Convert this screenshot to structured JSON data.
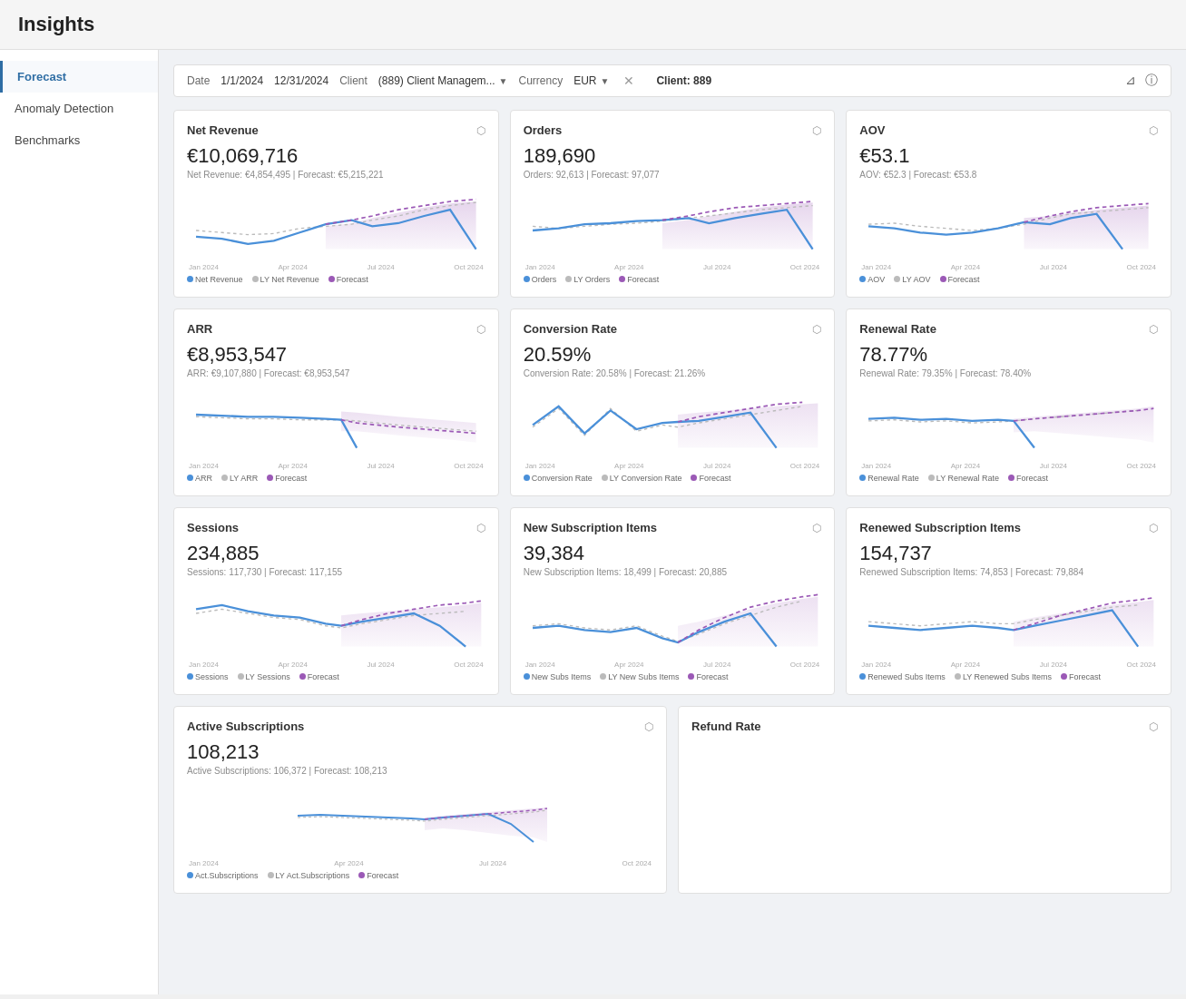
{
  "app": {
    "title": "Insights"
  },
  "sidebar": {
    "items": [
      {
        "label": "Forecast",
        "active": true
      },
      {
        "label": "Anomaly Detection",
        "active": false
      },
      {
        "label": "Benchmarks",
        "active": false
      }
    ]
  },
  "filters": {
    "date_label": "Date",
    "date_start": "1/1/2024",
    "date_end": "12/31/2024",
    "client_label": "Client",
    "client_value": "(889) Client Managem...",
    "currency_label": "Currency",
    "currency_value": "EUR",
    "client_badge": "Client: 889"
  },
  "cards": [
    {
      "id": "net-revenue",
      "title": "Net Revenue",
      "value": "€10,069,716",
      "subtitle": "Net Revenue: €4,854,495 | Forecast: €5,215,221",
      "x_labels": [
        "Jan 2024",
        "Apr 2024",
        "Jul 2024",
        "Oct 2024"
      ],
      "legend": [
        {
          "label": "Net Revenue",
          "color": "#4a90d9",
          "type": "solid"
        },
        {
          "label": "LY Net Revenue",
          "color": "#aaa",
          "type": "dashed"
        },
        {
          "label": "Forecast",
          "color": "#9b59b6",
          "type": "dashed"
        }
      ]
    },
    {
      "id": "orders",
      "title": "Orders",
      "value": "189,690",
      "subtitle": "Orders: 92,613 | Forecast: 97,077",
      "x_labels": [
        "Jan 2024",
        "Apr 2024",
        "Jul 2024",
        "Oct 2024"
      ],
      "legend": [
        {
          "label": "Orders",
          "color": "#4a90d9",
          "type": "solid"
        },
        {
          "label": "LY Orders",
          "color": "#aaa",
          "type": "dashed"
        },
        {
          "label": "Forecast",
          "color": "#9b59b6",
          "type": "dashed"
        }
      ]
    },
    {
      "id": "aov",
      "title": "AOV",
      "value": "€53.1",
      "subtitle": "AOV: €52.3 | Forecast: €53.8",
      "x_labels": [
        "Jan 2024",
        "Apr 2024",
        "Jul 2024",
        "Oct 2024"
      ],
      "legend": [
        {
          "label": "AOV",
          "color": "#4a90d9",
          "type": "solid"
        },
        {
          "label": "LY AOV",
          "color": "#aaa",
          "type": "dashed"
        },
        {
          "label": "Forecast",
          "color": "#9b59b6",
          "type": "dashed"
        }
      ]
    },
    {
      "id": "arr",
      "title": "ARR",
      "value": "€8,953,547",
      "subtitle": "ARR: €9,107,880 | Forecast: €8,953,547",
      "x_labels": [
        "Jan 2024",
        "Apr 2024",
        "Jul 2024",
        "Oct 2024"
      ],
      "legend": [
        {
          "label": "ARR",
          "color": "#4a90d9",
          "type": "solid"
        },
        {
          "label": "LY ARR",
          "color": "#aaa",
          "type": "dashed"
        },
        {
          "label": "Forecast",
          "color": "#9b59b6",
          "type": "dashed"
        }
      ]
    },
    {
      "id": "conversion-rate",
      "title": "Conversion Rate",
      "value": "20.59%",
      "subtitle": "Conversion Rate: 20.58% | Forecast: 21.26%",
      "x_labels": [
        "Jan 2024",
        "Apr 2024",
        "Jul 2024",
        "Oct 2024"
      ],
      "legend": [
        {
          "label": "Conversion Rate",
          "color": "#4a90d9",
          "type": "solid"
        },
        {
          "label": "LY Conversion Rate",
          "color": "#aaa",
          "type": "dashed"
        },
        {
          "label": "Forecast",
          "color": "#9b59b6",
          "type": "dashed"
        }
      ]
    },
    {
      "id": "renewal-rate",
      "title": "Renewal Rate",
      "value": "78.77%",
      "subtitle": "Renewal Rate: 79.35% | Forecast: 78.40%",
      "x_labels": [
        "Jan 2024",
        "Apr 2024",
        "Jul 2024",
        "Oct 2024"
      ],
      "legend": [
        {
          "label": "Renewal Rate",
          "color": "#4a90d9",
          "type": "solid"
        },
        {
          "label": "LY Renewal Rate",
          "color": "#aaa",
          "type": "dashed"
        },
        {
          "label": "Forecast",
          "color": "#9b59b6",
          "type": "dashed"
        }
      ]
    },
    {
      "id": "sessions",
      "title": "Sessions",
      "value": "234,885",
      "subtitle": "Sessions: 117,730 | Forecast: 117,155",
      "x_labels": [
        "Jan 2024",
        "Apr 2024",
        "Jul 2024",
        "Oct 2024"
      ],
      "legend": [
        {
          "label": "Sessions",
          "color": "#4a90d9",
          "type": "solid"
        },
        {
          "label": "LY Sessions",
          "color": "#aaa",
          "type": "dashed"
        },
        {
          "label": "Forecast",
          "color": "#9b59b6",
          "type": "dashed"
        }
      ]
    },
    {
      "id": "new-subscription-items",
      "title": "New Subscription Items",
      "value": "39,384",
      "subtitle": "New Subscription Items: 18,499 | Forecast: 20,885",
      "x_labels": [
        "Jan 2024",
        "Apr 2024",
        "Jul 2024",
        "Oct 2024"
      ],
      "legend": [
        {
          "label": "New Subs Items",
          "color": "#4a90d9",
          "type": "solid"
        },
        {
          "label": "LY New Subs Items",
          "color": "#aaa",
          "type": "dashed"
        },
        {
          "label": "Forecast",
          "color": "#9b59b6",
          "type": "dashed"
        }
      ]
    },
    {
      "id": "renewed-subscription-items",
      "title": "Renewed Subscription Items",
      "value": "154,737",
      "subtitle": "Renewed Subscription Items: 74,853 | Forecast: 79,884",
      "x_labels": [
        "Jan 2024",
        "Apr 2024",
        "Jul 2024",
        "Oct 2024"
      ],
      "legend": [
        {
          "label": "Renewed Subs Items",
          "color": "#4a90d9",
          "type": "solid"
        },
        {
          "label": "LY Renewed Subs Items",
          "color": "#aaa",
          "type": "dashed"
        },
        {
          "label": "Forecast",
          "color": "#9b59b6",
          "type": "dashed"
        }
      ]
    },
    {
      "id": "active-subscriptions",
      "title": "Active Subscriptions",
      "value": "108,213",
      "subtitle": "Active Subscriptions: 106,372 | Forecast: 108,213",
      "x_labels": [
        "Jan 2024",
        "Apr 2024",
        "Jul 2024",
        "Oct 2024"
      ],
      "legend": [
        {
          "label": "Act.Subscriptions",
          "color": "#4a90d9",
          "type": "solid"
        },
        {
          "label": "LY Act.Subscriptions",
          "color": "#aaa",
          "type": "dashed"
        },
        {
          "label": "Forecast",
          "color": "#9b59b6",
          "type": "dashed"
        }
      ]
    },
    {
      "id": "refund-rate",
      "title": "Refund Rate",
      "value": "",
      "subtitle": "",
      "x_labels": [],
      "legend": []
    }
  ],
  "chart_colors": {
    "blue": "#4a90d9",
    "gray_dashed": "#bbb",
    "purple_dashed": "#9b59b6",
    "forecast_fill": "rgba(155,89,182,0.12)"
  }
}
